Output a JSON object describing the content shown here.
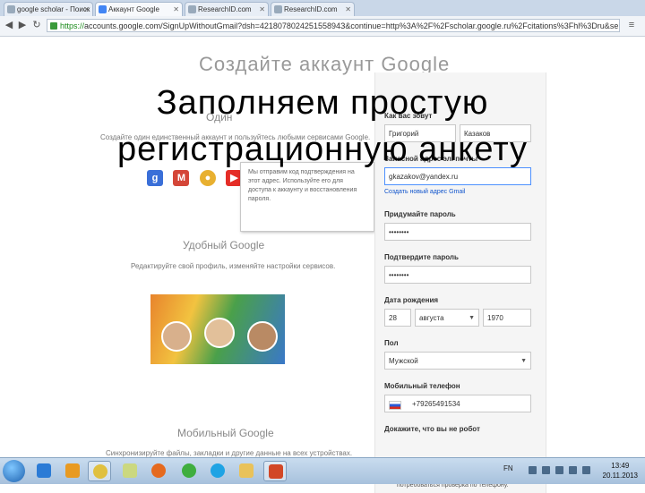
{
  "browser": {
    "tabs": [
      {
        "label": "google scholar - Поиск в",
        "active": false
      },
      {
        "label": "Аккаунт Google",
        "active": true
      },
      {
        "label": "ResearchID.com",
        "active": false
      },
      {
        "label": "ResearchID.com",
        "active": false
      }
    ],
    "url_https": "https://",
    "url_rest": "accounts.google.com/SignUpWithoutGmail?dsh=421807802425155894З&continue=http%3A%2F%2Fscholar.google.ru%2Fcitations%3Fhl%3Dru&service=citations"
  },
  "page": {
    "heading": "Создайте аккаунт Google",
    "subheading": "Один",
    "intro": "Создайте один единственный аккаунт и пользуйтесь любыми сервисами Google.",
    "tooltip": "Мы отправим код подтверждения на этот адрес. Используйте его для доступа к аккаунту и восстановления пароля.",
    "section2_title": "Удобный Google",
    "section2_desc": "Редактируйте свой профиль, изменяйте настройки сервисов.",
    "section3_title": "Мобильный Google",
    "section3_desc": "Синхронизируйте файлы, закладки и другие данные на всех устройствах."
  },
  "form": {
    "name_label": "Как вас зовут",
    "first_name": "Григорий",
    "last_name": "Казаков",
    "email_label": "Запасной адрес эл. почты",
    "email": "gkazakov@yandex.ru",
    "email_link": "Создать новый адрес Gmail",
    "password_label": "Придумайте пароль",
    "password": "••••••••",
    "confirm_label": "Подтвердите пароль",
    "confirm": "••••••••",
    "birth_label": "Дата рождения",
    "birth_day": "28",
    "birth_month": "августа",
    "birth_year": "1970",
    "gender_label": "Пол",
    "gender": "Мужской",
    "phone_label": "Мобильный телефон",
    "phone": "+79265491534",
    "robot_label": "Докажите, что вы не робот",
    "robot_text": "Пропустить эту проверку. Может потребоваться проверка по телефону."
  },
  "overlay": {
    "line1": "Заполняем простую",
    "line2": "регистрационную анкету"
  },
  "taskbar": {
    "lang": "FN",
    "time": "13:49",
    "date": "20.11.2013"
  }
}
